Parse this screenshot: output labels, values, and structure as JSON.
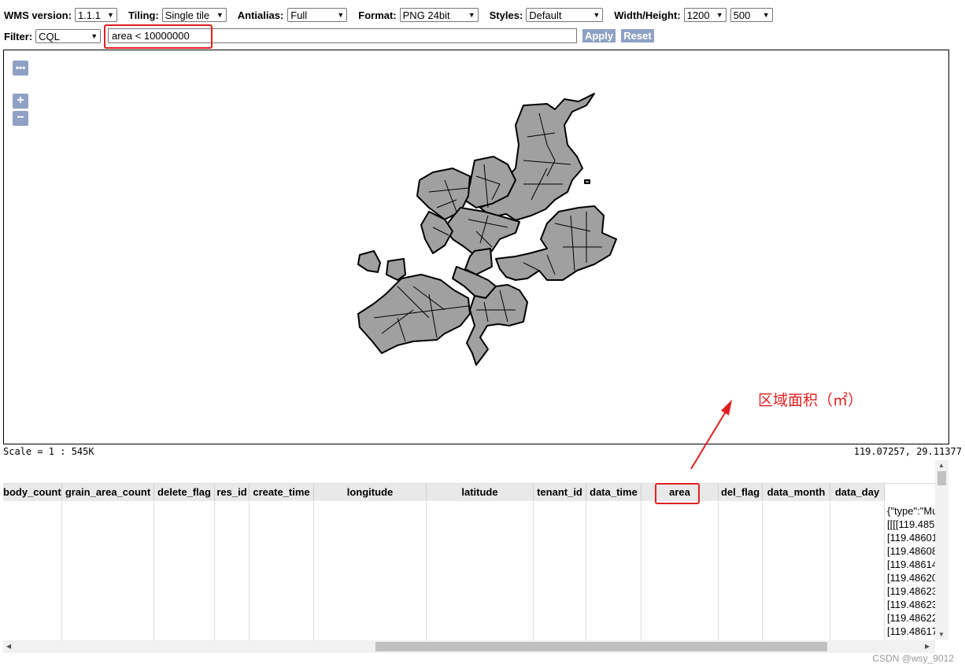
{
  "toolbar": {
    "wms_version_label": "WMS version:",
    "wms_version_value": "1.1.1",
    "tiling_label": "Tiling:",
    "tiling_value": "Single tile",
    "antialias_label": "Antialias:",
    "antialias_value": "Full",
    "format_label": "Format:",
    "format_value": "PNG 24bit",
    "styles_label": "Styles:",
    "styles_value": "Default",
    "size_label": "Width/Height:",
    "width_value": "1200",
    "height_value": "500"
  },
  "filter": {
    "label": "Filter:",
    "type_value": "CQL",
    "expression": "area < 10000000",
    "apply_label": "Apply",
    "reset_label": "Reset"
  },
  "map": {
    "controls": {
      "more": "•••",
      "zoom_in": "+",
      "zoom_out": "−"
    },
    "scale_text": "Scale = 1 : 545K",
    "coordinates_text": "119.07257, 29.11377",
    "fill_color": "#a0a0a0",
    "stroke_color": "#000000"
  },
  "annotation": {
    "text": "区域面积（㎡）",
    "color": "#e02020"
  },
  "table": {
    "columns": [
      "body_count",
      "grain_area_count",
      "delete_flag",
      "res_id",
      "create_time",
      "longitude",
      "latitude",
      "tenant_id",
      "data_time",
      "area",
      "del_flag",
      "data_month",
      "data_day"
    ],
    "geometry_lines": [
      "{\"type\":\"Mu",
      "[[[[119.485",
      "[119.48601",
      "[119.48608",
      "[119.48614",
      "[119.48620",
      "[119.48623",
      "[119.48623",
      "[119.48622",
      "[119.48617"
    ]
  },
  "watermark": "CSDN @wsy_9012"
}
